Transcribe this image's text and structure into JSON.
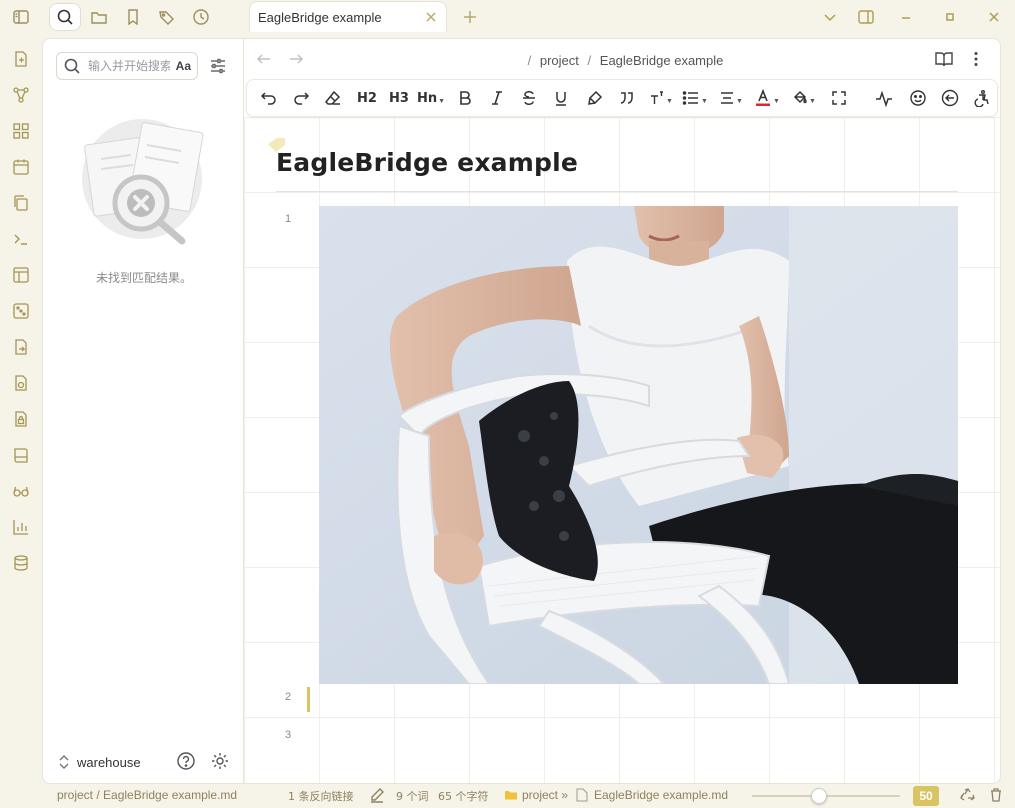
{
  "tab": {
    "title": "EagleBridge example",
    "new_tab_label": "+"
  },
  "top_icons": [
    "sidebar-toggle-icon",
    "search-icon",
    "folder-icon",
    "bookmark-icon",
    "tags-icon",
    "clock-icon"
  ],
  "ribbon_icons": [
    "file-plus-icon",
    "graph-icon",
    "grid-icon",
    "calendar-icon",
    "copy-icon",
    "terminal-icon",
    "layout-icon",
    "dice-icon",
    "file-export-icon",
    "file-sync-icon",
    "file-lock-icon",
    "book-icon",
    "glasses-icon",
    "bar-chart-icon",
    "database-icon"
  ],
  "search": {
    "placeholder": "输入并开始搜索...",
    "match_case_label": "Aa",
    "empty_message": "未找到匹配结果。"
  },
  "vault": {
    "name": "warehouse"
  },
  "breadcrumb": {
    "folder": "project",
    "separator": "/",
    "file": "EagleBridge example"
  },
  "toolbar": {
    "h2": "H2",
    "h3": "H3",
    "hn": "Hn"
  },
  "document": {
    "title": "EagleBridge example",
    "line_numbers": [
      "1",
      "2",
      "3"
    ]
  },
  "statusbar": {
    "path": "project / EagleBridge example.md",
    "backlinks": "1 条反向链接",
    "words": "9 个词",
    "chars": "65 个字符",
    "folder": "project »",
    "file": "EagleBridge example.md",
    "zoom": "50",
    "zoom_fraction": 0.45
  },
  "colors": {
    "accent": "#d9c463",
    "text_color_bar": "#e0242c"
  }
}
